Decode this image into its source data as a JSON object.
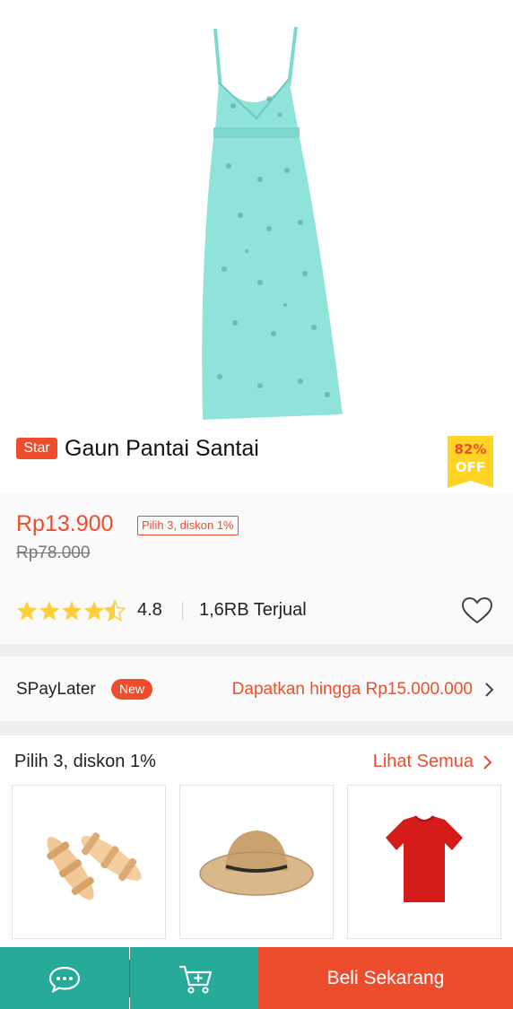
{
  "product": {
    "badge": "Star",
    "title": "Gaun Pantai Santai",
    "discount_pct": "82%",
    "discount_off": "OFF",
    "price": "Rp13.900",
    "promo": "Pilih 3, diskon 1%",
    "old_price": "Rp78.000",
    "rating": "4.8",
    "rating_stars": 4.5,
    "sold": "1,6RB Terjual"
  },
  "paylater": {
    "label": "SPayLater",
    "badge": "New",
    "cta": "Dapatkan hingga Rp15.000.000"
  },
  "bundle": {
    "title": "Pilih 3, diskon 1%",
    "see_all": "Lihat Semua",
    "items": [
      "sandals",
      "straw-hat",
      "red-tshirt"
    ]
  },
  "bottom_bar": {
    "buy_label": "Beli Sekarang"
  },
  "colors": {
    "accent": "#ee4d2d",
    "teal": "#26aa99",
    "badge_yellow": "#ffd424"
  }
}
